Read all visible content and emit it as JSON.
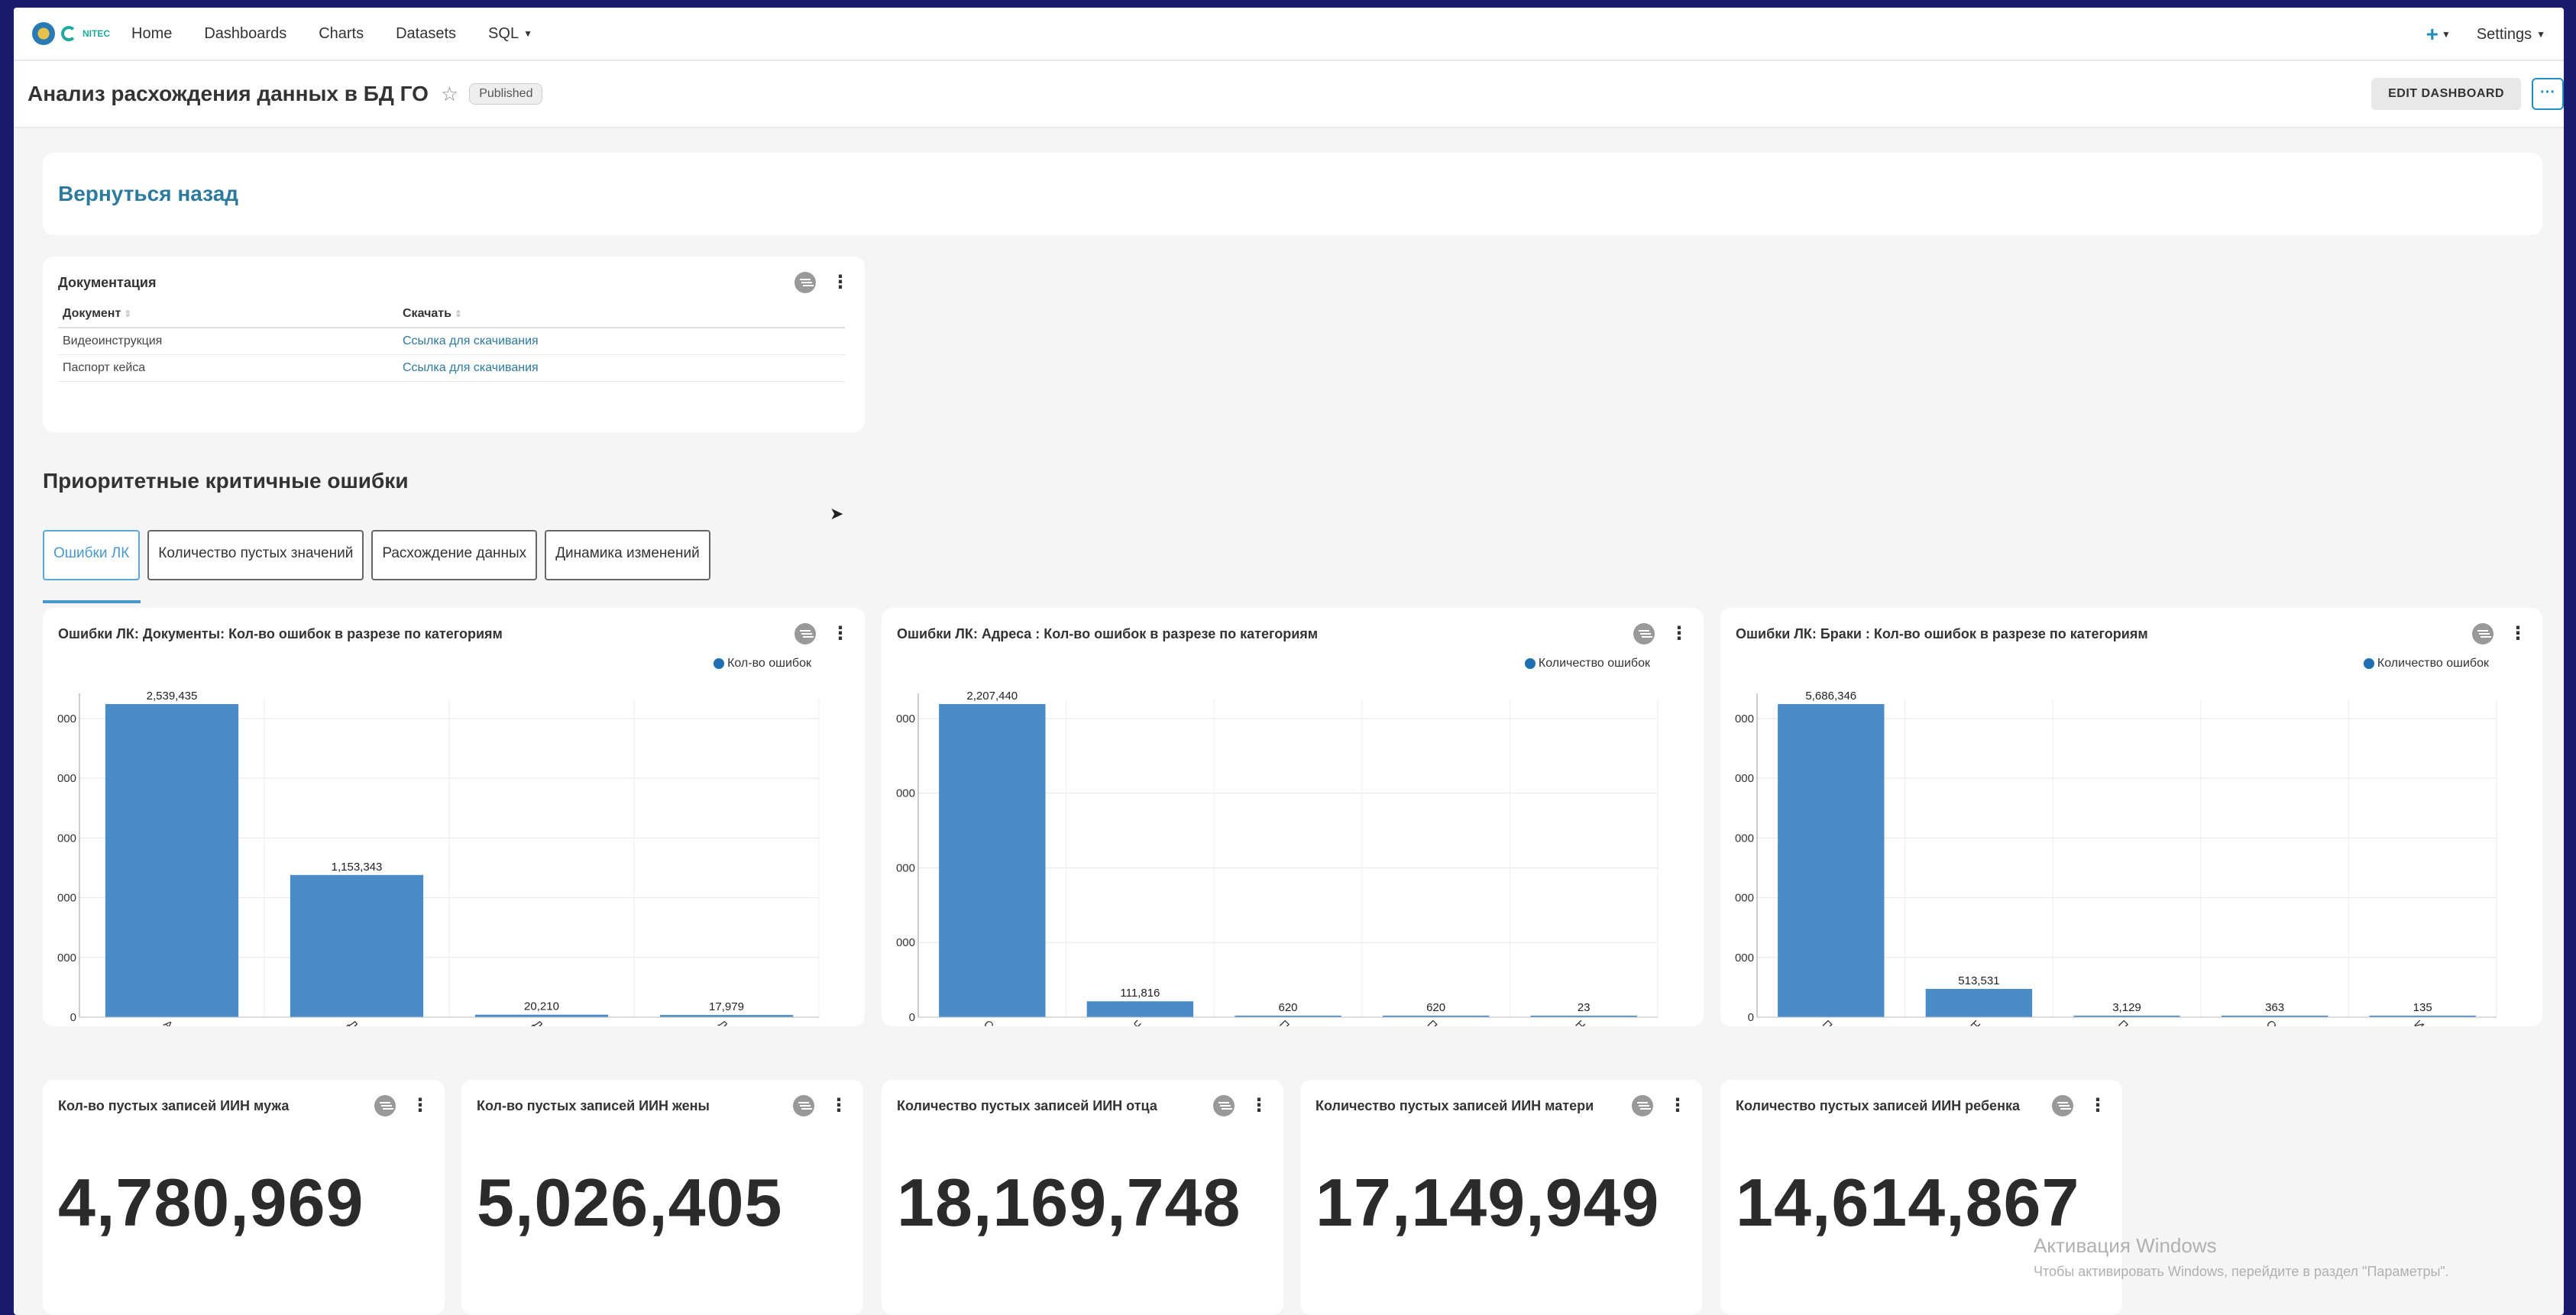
{
  "nav": {
    "logo_text": "NITEC",
    "items": [
      {
        "label": "Home"
      },
      {
        "label": "Dashboards"
      },
      {
        "label": "Charts"
      },
      {
        "label": "Datasets"
      },
      {
        "label": "SQL"
      }
    ],
    "settings_label": "Settings"
  },
  "header": {
    "title": "Анализ расхождения данных в БД ГО",
    "badge": "Published",
    "edit_label": "EDIT DASHBOARD",
    "more_label": "···"
  },
  "back_link": "Вернуться назад",
  "documentation": {
    "title": "Документация",
    "columns": [
      "Документ",
      "Скачать"
    ],
    "rows": [
      {
        "doc": "Видеоинструкция",
        "link": "Ссылка для скачивания"
      },
      {
        "doc": "Паспорт кейса",
        "link": "Ссылка для скачивания"
      }
    ]
  },
  "section_title": "Приоритетные критичные ошибки",
  "tabs": [
    {
      "label": "Ошибки ЛК",
      "active": true
    },
    {
      "label": "Количество пустых значений",
      "active": false
    },
    {
      "label": "Расхождение данных",
      "active": false
    },
    {
      "label": "Динамика изменений",
      "active": false
    }
  ],
  "chart_data": [
    {
      "type": "bar",
      "title": "Ошибки ЛК: Документы: Кол-во ошибок в разрезе по категориям",
      "legend": "Кол-во ошибок",
      "categories": [
        "Актуал",
        "Докум",
        "Докум",
        "Лица у"
      ],
      "values": [
        2539435,
        1153343,
        20210,
        17979
      ],
      "value_labels": [
        "2,539,435",
        "1,153,343",
        "20,210",
        "17,979"
      ],
      "ylim": [
        0,
        2539435
      ],
      "ytick_labels": [
        "0",
        "000",
        "000",
        "000",
        "000",
        "000"
      ],
      "color": "#4a8cc7"
    },
    {
      "type": "bar",
      "title": "Ошибки ЛК: Адреса : Кол-во ошибок в разрезе по категориям",
      "legend": "Количество ошибок",
      "categories": [
        "Спрос",
        "Челов",
        "Пусто",
        "Пусто",
        "Неуаг"
      ],
      "values": [
        2207440,
        111816,
        620,
        620,
        23
      ],
      "value_labels": [
        "2,207,440",
        "111,816",
        "620",
        "620",
        "23"
      ],
      "ylim": [
        0,
        2207440
      ],
      "ytick_labels": [
        "0",
        "000",
        "000",
        "000",
        "000"
      ],
      "color": "#4a8cc7"
    },
    {
      "type": "bar",
      "title": "Ошибки ЛК: Браки : Кол-во ошибок в разрезе по категориям",
      "legend": "Количество ошибок",
      "categories": [
        "Пусты",
        "Несоо",
        "Перел",
        "Одина",
        "Имеют"
      ],
      "values": [
        5686346,
        513531,
        3129,
        363,
        135
      ],
      "value_labels": [
        "5,686,346",
        "513,531",
        "3,129",
        "363",
        "135"
      ],
      "ylim": [
        0,
        5686346
      ],
      "ytick_labels": [
        "0",
        "000",
        "000",
        "000",
        "000",
        "000"
      ],
      "color": "#4a8cc7"
    }
  ],
  "kpis": [
    {
      "title": "Кол-во пустых записей ИИН мужа",
      "value": "4,780,969"
    },
    {
      "title": "Кол-во пустых записей ИИН жены",
      "value": "5,026,405"
    },
    {
      "title": "Количество пустых записей ИИН отца",
      "value": "18,169,748"
    },
    {
      "title": "Количество пустых записей ИИН матери",
      "value": "17,149,949"
    },
    {
      "title": "Количество пустых записей ИИН ребенка",
      "value": "14,614,867"
    }
  ],
  "watermark": {
    "line1": "Активация Windows",
    "line2": "Чтобы активировать Windows, перейдите в раздел \"Параметры\"."
  }
}
